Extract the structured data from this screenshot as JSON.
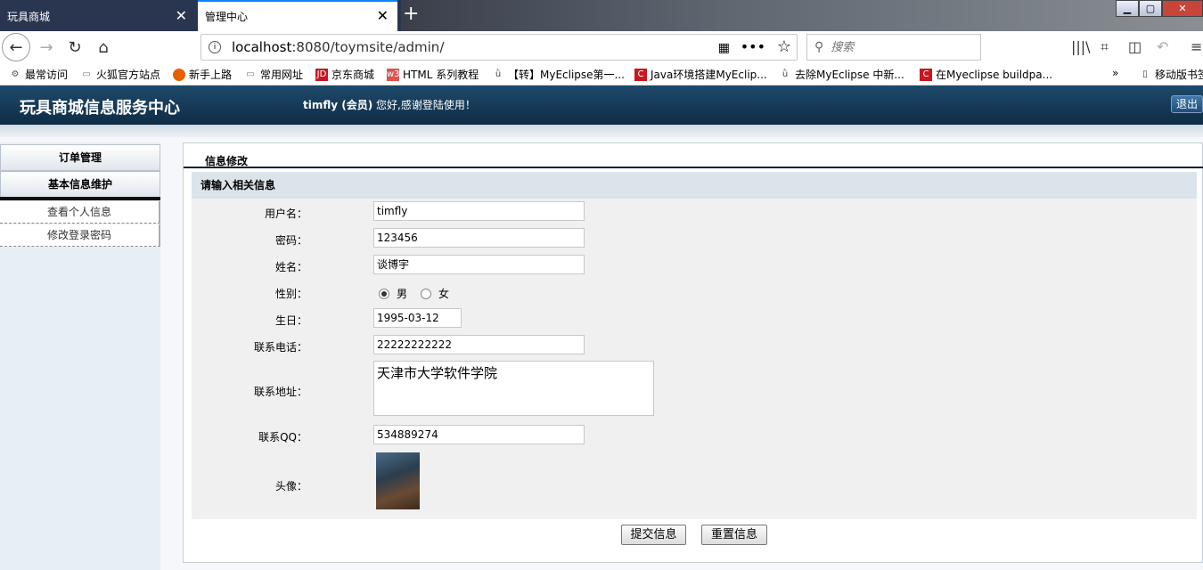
{
  "browser": {
    "tabs": [
      {
        "label": "玩具商城"
      },
      {
        "label": "管理中心"
      }
    ],
    "url_host": "localhost",
    "url_rest": ":8080/toymsite/admin/",
    "search_placeholder": "搜索",
    "bookmarks": [
      {
        "label": "最常访问"
      },
      {
        "label": "火狐官方站点"
      },
      {
        "label": "新手上路"
      },
      {
        "label": "常用网址"
      },
      {
        "label": "京东商城"
      },
      {
        "label": "HTML 系列教程"
      },
      {
        "label": "【转】MyEclipse第一..."
      },
      {
        "label": "Java环境搭建MyEclip..."
      },
      {
        "label": "去除MyEclipse 中新..."
      },
      {
        "label": "在Myeclipse buildpa..."
      },
      {
        "label": "移动版书签"
      }
    ]
  },
  "header": {
    "title": "玩具商城信息服务中心",
    "welcome_user": "timfly (会员)",
    "welcome_text": " 您好,感谢登陆使用！",
    "logout_label": "退出"
  },
  "sidebar": {
    "section1": "订单管理",
    "section2": "基本信息维护",
    "items": [
      {
        "label": "查看个人信息"
      },
      {
        "label": "修改登录密码"
      }
    ]
  },
  "main": {
    "tab_label": "信息修改",
    "form_heading": "请输入相关信息",
    "fields": {
      "username_label": "用户名：",
      "username": "timfly",
      "password_label": "密码：",
      "password": "123456",
      "name_label": "姓名：",
      "name": "谈博宇",
      "gender_label": "性别：",
      "gender_male": "男",
      "gender_female": "女",
      "gender_selected": "男",
      "birthday_label": "生日：",
      "birthday": "1995-03-12",
      "phone_label": "联系电话：",
      "phone": "22222222222",
      "address_label": "联系地址：",
      "address": "天津市大学软件学院",
      "qq_label": "联系QQ：",
      "qq": "534889274",
      "avatar_label": "头像："
    },
    "submit_label": "提交信息",
    "reset_label": "重置信息"
  }
}
